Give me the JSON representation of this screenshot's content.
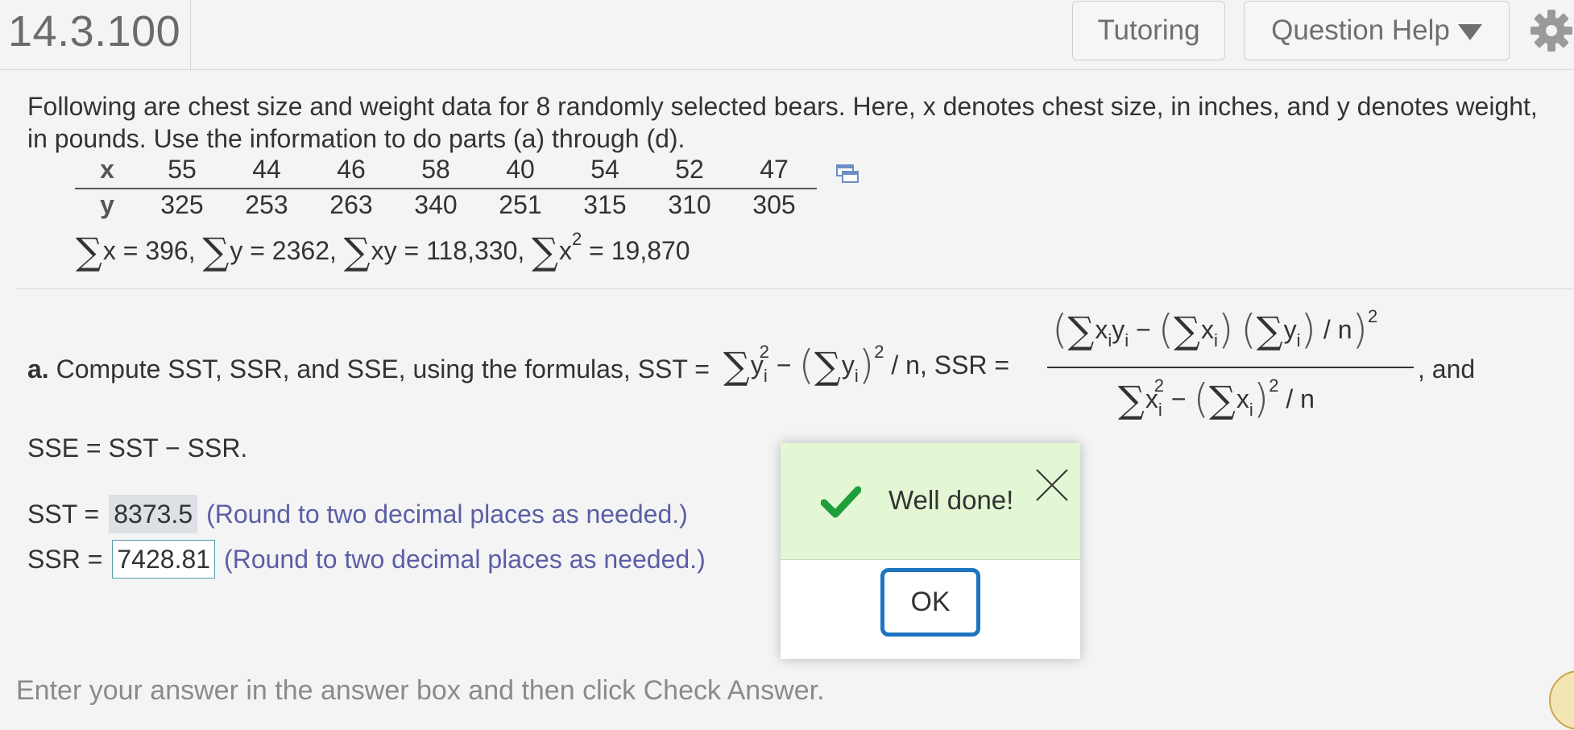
{
  "header": {
    "question_number": "14.3.100",
    "tutoring_label": "Tutoring",
    "question_help_label": "Question Help",
    "settings_icon": "gear-icon"
  },
  "problem": {
    "prompt": "Following are chest size and weight data for 8 randomly selected bears. Here, x denotes chest size, in inches, and y denotes weight, in pounds. Use the information to do parts (a) through (d).",
    "table": {
      "x_label": "x",
      "y_label": "y",
      "x": [
        "55",
        "44",
        "46",
        "58",
        "40",
        "54",
        "52",
        "47"
      ],
      "y": [
        "325",
        "253",
        "263",
        "340",
        "251",
        "315",
        "310",
        "305"
      ]
    },
    "sums": {
      "sum_x": "x = 396,",
      "sum_y": "y = 2362,",
      "sum_xy": "xy = 118,330,",
      "sum_x2_base": "x",
      "sum_x2_exp": "2",
      "sum_x2_val": " = 19,870"
    }
  },
  "part_a": {
    "label": "a.",
    "text": "Compute SST, SSR, and SSE, using the formulas, SST =",
    "ssr_text": "/ n, SSR =",
    "and_text": ", and",
    "sse_text": "SSE = SST − SSR.",
    "sst_label": "SST =",
    "sst_value": "8373.5",
    "ssr_label": "SSR =",
    "ssr_value": "7428.81",
    "round_hint": "(Round to two decimal places as needed.)"
  },
  "footer": {
    "instruction": "Enter your answer in the answer box and then click Check Answer."
  },
  "dialog": {
    "message": "Well done!",
    "ok_label": "OK"
  }
}
